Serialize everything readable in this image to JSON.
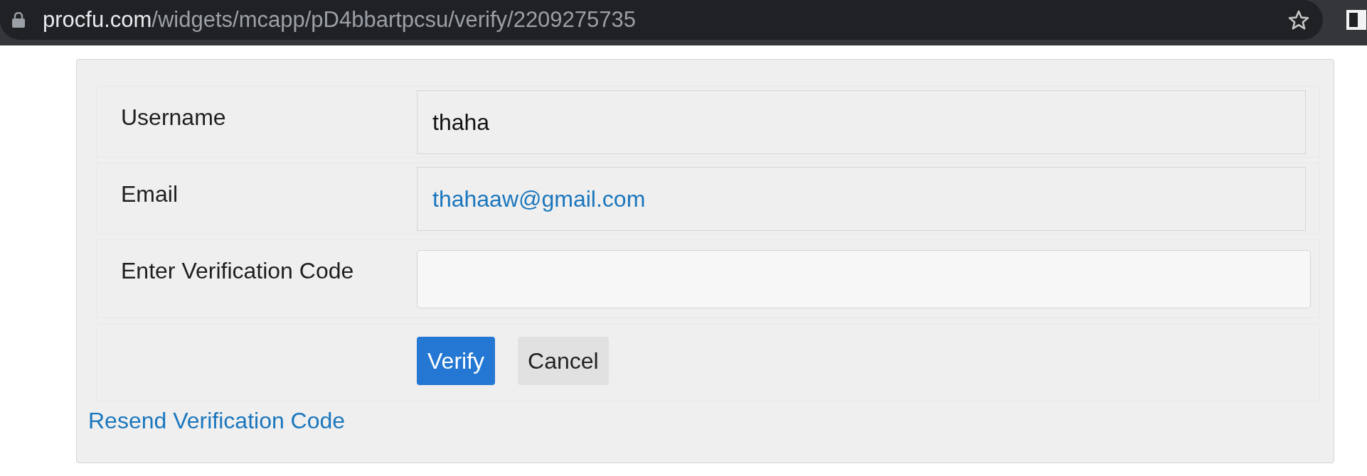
{
  "browser": {
    "address_bar": {
      "host": "procfu.com",
      "path": "/widgets/mcapp/pD4bbartpcsu/verify/2209275735"
    }
  },
  "form": {
    "fields": [
      {
        "label": "Username",
        "kind": "text",
        "value": "thaha"
      },
      {
        "label": "Email",
        "kind": "link",
        "value": "thahaaw@gmail.com"
      },
      {
        "label": "Enter Verification Code",
        "kind": "input"
      }
    ],
    "buttons": [
      {
        "label": "Verify",
        "kind": "submit"
      },
      {
        "label": "Cancel",
        "kind": "cancel"
      }
    ],
    "resend_link": "Resend Verification Code"
  }
}
